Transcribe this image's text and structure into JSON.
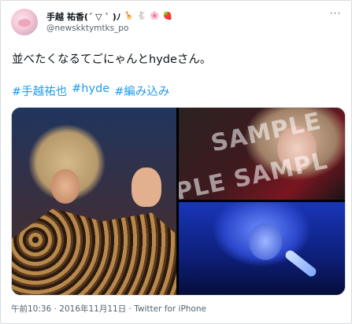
{
  "user": {
    "display_name": "手越 祐香(´ ▽ ` )ﾉ",
    "emojis": {
      "giraffe": "🦒",
      "rabbit": "🐇",
      "flower": "🌸",
      "heart": "🍓"
    },
    "handle": "@newskktymtks_po"
  },
  "more_button": "···",
  "tweet": {
    "text": "並べたくなるてごにゃんとhydeさん。",
    "hashtags": [
      "#手越祐也",
      "#hyde",
      "#編み込み"
    ]
  },
  "media": {
    "watermark_line1": "SAMPLE",
    "watermark_line2": "PLE  SAMPL"
  },
  "meta": {
    "timestamp": "午前10:36 · 2016年11月11日 · Twitter for iPhone"
  }
}
